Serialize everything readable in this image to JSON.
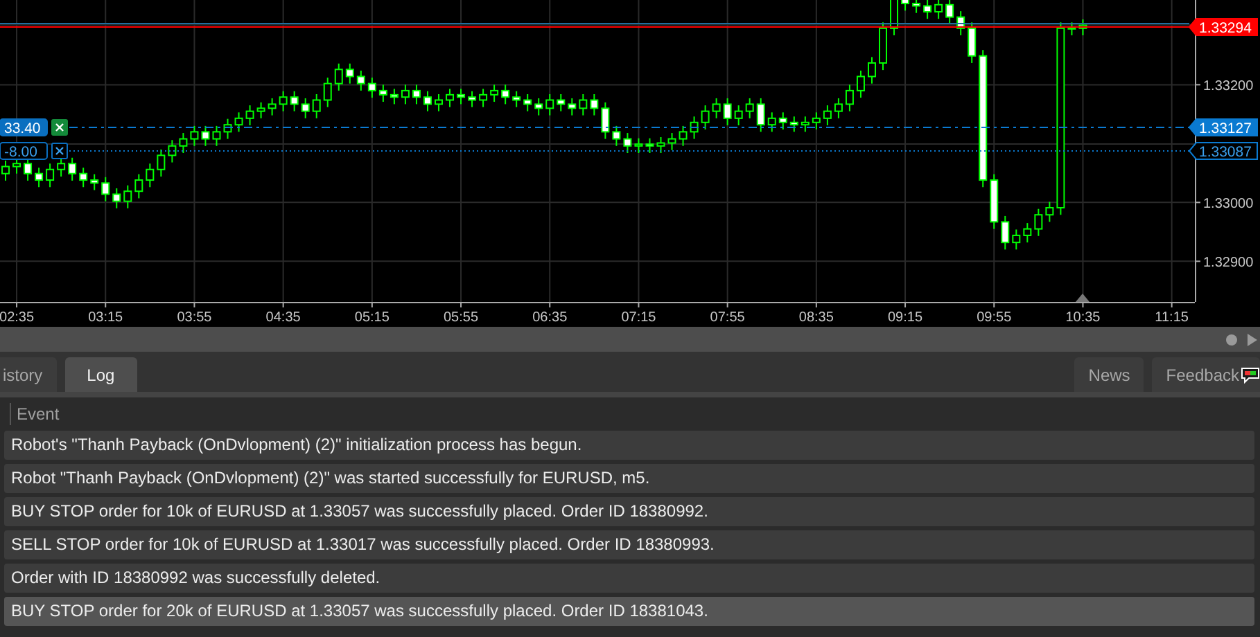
{
  "chart": {
    "chart_data": {
      "type": "candlestick",
      "x": [
        150,
        155,
        160,
        165,
        170,
        175,
        180,
        185,
        190,
        195,
        200,
        205,
        210,
        215,
        220,
        225,
        230,
        235,
        240,
        245,
        250,
        255,
        260,
        265,
        270,
        275,
        280,
        285,
        290,
        295,
        300,
        305,
        310,
        315,
        320,
        325,
        330,
        335,
        340,
        345,
        350,
        355,
        360,
        365,
        370,
        375,
        380,
        385,
        390,
        395,
        400,
        405,
        410,
        415,
        420,
        425,
        430,
        435,
        440,
        445,
        450,
        455,
        460,
        465,
        470,
        475,
        480,
        485,
        490,
        495,
        500,
        505,
        510,
        515,
        520,
        525,
        530,
        535,
        540,
        545,
        550,
        555,
        560,
        565,
        570,
        575,
        580,
        585,
        590,
        595,
        600,
        605,
        610,
        615,
        620,
        625,
        630,
        635
      ],
      "xlim": [
        147.5,
        685.4
      ],
      "grid": true,
      "ohlc": [
        [
          1.33049,
          1.33071,
          1.33037,
          1.33061
        ],
        [
          1.33061,
          1.33076,
          1.33049,
          1.33066
        ],
        [
          1.33066,
          1.33076,
          1.33037,
          1.33049
        ],
        [
          1.33049,
          1.33059,
          1.33026,
          1.33038
        ],
        [
          1.33038,
          1.33066,
          1.33026,
          1.33056
        ],
        [
          1.33056,
          1.33076,
          1.33044,
          1.33066
        ],
        [
          1.33066,
          1.33076,
          1.33037,
          1.33049
        ],
        [
          1.33049,
          1.33059,
          1.33026,
          1.33038
        ],
        [
          1.33038,
          1.33048,
          1.33021,
          1.33033
        ],
        [
          1.33033,
          1.33043,
          1.33002,
          1.33014
        ],
        [
          1.33014,
          1.33024,
          1.3299,
          1.33002
        ],
        [
          1.33002,
          1.33029,
          1.3299,
          1.33019
        ],
        [
          1.33019,
          1.33048,
          1.33007,
          1.33038
        ],
        [
          1.33038,
          1.33066,
          1.33026,
          1.33056
        ],
        [
          1.33056,
          1.3309,
          1.33044,
          1.3308
        ],
        [
          1.3308,
          1.33106,
          1.33068,
          1.33096
        ],
        [
          1.33096,
          1.33118,
          1.33084,
          1.33108
        ],
        [
          1.33108,
          1.3313,
          1.33096,
          1.3312
        ],
        [
          1.3312,
          1.3313,
          1.33096,
          1.33108
        ],
        [
          1.33108,
          1.3313,
          1.33096,
          1.3312
        ],
        [
          1.3312,
          1.33142,
          1.33108,
          1.33132
        ],
        [
          1.33132,
          1.33153,
          1.3312,
          1.33143
        ],
        [
          1.33143,
          1.33165,
          1.33131,
          1.33155
        ],
        [
          1.33155,
          1.3317,
          1.33143,
          1.3316
        ],
        [
          1.3316,
          1.33177,
          1.33148,
          1.33167
        ],
        [
          1.33167,
          1.33189,
          1.33155,
          1.33179
        ],
        [
          1.33179,
          1.33189,
          1.33155,
          1.33167
        ],
        [
          1.33167,
          1.33177,
          1.33143,
          1.33155
        ],
        [
          1.33155,
          1.33184,
          1.33143,
          1.33174
        ],
        [
          1.33174,
          1.33212,
          1.33162,
          1.33202
        ],
        [
          1.33202,
          1.33236,
          1.3319,
          1.33226
        ],
        [
          1.33226,
          1.33236,
          1.33202,
          1.33214
        ],
        [
          1.33214,
          1.33224,
          1.3319,
          1.33202
        ],
        [
          1.33202,
          1.33212,
          1.33178,
          1.3319
        ],
        [
          1.3319,
          1.332,
          1.33171,
          1.33183
        ],
        [
          1.33183,
          1.33193,
          1.33167,
          1.33179
        ],
        [
          1.33179,
          1.332,
          1.33167,
          1.3319
        ],
        [
          1.3319,
          1.332,
          1.33167,
          1.33179
        ],
        [
          1.33179,
          1.33189,
          1.33155,
          1.33167
        ],
        [
          1.33167,
          1.33184,
          1.33155,
          1.33174
        ],
        [
          1.33174,
          1.33193,
          1.33162,
          1.33183
        ],
        [
          1.33183,
          1.33193,
          1.33167,
          1.33179
        ],
        [
          1.33179,
          1.33189,
          1.33162,
          1.33174
        ],
        [
          1.33174,
          1.33193,
          1.33162,
          1.33183
        ],
        [
          1.33183,
          1.332,
          1.33171,
          1.3319
        ],
        [
          1.3319,
          1.332,
          1.33167,
          1.33179
        ],
        [
          1.33179,
          1.33189,
          1.33162,
          1.33174
        ],
        [
          1.33174,
          1.33184,
          1.33155,
          1.33167
        ],
        [
          1.33167,
          1.33177,
          1.33148,
          1.3316
        ],
        [
          1.3316,
          1.33184,
          1.33148,
          1.33174
        ],
        [
          1.33174,
          1.33184,
          1.33155,
          1.33167
        ],
        [
          1.33167,
          1.33177,
          1.33148,
          1.3316
        ],
        [
          1.3316,
          1.33184,
          1.33148,
          1.33174
        ],
        [
          1.33174,
          1.33184,
          1.33148,
          1.3316
        ],
        [
          1.3316,
          1.3317,
          1.33108,
          1.3312
        ],
        [
          1.3312,
          1.3313,
          1.33096,
          1.33108
        ],
        [
          1.33108,
          1.33118,
          1.33084,
          1.33096
        ],
        [
          1.33096,
          1.33109,
          1.33084,
          1.33099
        ],
        [
          1.33099,
          1.33109,
          1.33084,
          1.33096
        ],
        [
          1.33096,
          1.33111,
          1.33084,
          1.33101
        ],
        [
          1.33101,
          1.33118,
          1.33089,
          1.33108
        ],
        [
          1.33108,
          1.3313,
          1.33096,
          1.3312
        ],
        [
          1.3312,
          1.33146,
          1.33108,
          1.33136
        ],
        [
          1.33136,
          1.33165,
          1.33124,
          1.33155
        ],
        [
          1.33155,
          1.33177,
          1.33143,
          1.33167
        ],
        [
          1.33167,
          1.33177,
          1.33131,
          1.33143
        ],
        [
          1.33143,
          1.33165,
          1.33131,
          1.33155
        ],
        [
          1.33155,
          1.33177,
          1.33143,
          1.33167
        ],
        [
          1.33167,
          1.33177,
          1.3312,
          1.33132
        ],
        [
          1.33132,
          1.33153,
          1.3312,
          1.33143
        ],
        [
          1.33143,
          1.33153,
          1.33124,
          1.33136
        ],
        [
          1.33136,
          1.33146,
          1.3312,
          1.33132
        ],
        [
          1.33132,
          1.33146,
          1.3312,
          1.33136
        ],
        [
          1.33136,
          1.33153,
          1.33124,
          1.33143
        ],
        [
          1.33143,
          1.33165,
          1.33131,
          1.33155
        ],
        [
          1.33155,
          1.33177,
          1.33143,
          1.33167
        ],
        [
          1.33167,
          1.332,
          1.33155,
          1.3319
        ],
        [
          1.3319,
          1.33224,
          1.33178,
          1.33214
        ],
        [
          1.33214,
          1.33247,
          1.33202,
          1.33237
        ],
        [
          1.33237,
          1.33306,
          1.33225,
          1.33296
        ],
        [
          1.33296,
          1.33365,
          1.33284,
          1.33355
        ],
        [
          1.33355,
          1.33365,
          1.33326,
          1.33338
        ],
        [
          1.33338,
          1.33348,
          1.33322,
          1.33334
        ],
        [
          1.33334,
          1.33344,
          1.33312,
          1.33324
        ],
        [
          1.33324,
          1.33346,
          1.33312,
          1.33336
        ],
        [
          1.33336,
          1.33346,
          1.33303,
          1.33315
        ],
        [
          1.33315,
          1.33325,
          1.33284,
          1.33296
        ],
        [
          1.33296,
          1.33306,
          1.33237,
          1.33249
        ],
        [
          1.33249,
          1.33259,
          1.33026,
          1.33038
        ],
        [
          1.33038,
          1.33048,
          1.32955,
          1.32967
        ],
        [
          1.32967,
          1.32977,
          1.3292,
          1.32932
        ],
        [
          1.32932,
          1.32954,
          1.3292,
          1.32944
        ],
        [
          1.32944,
          1.32965,
          1.32932,
          1.32955
        ],
        [
          1.32955,
          1.32989,
          1.32943,
          1.32979
        ],
        [
          1.32979,
          1.33001,
          1.32967,
          1.32991
        ],
        [
          1.32991,
          1.33306,
          1.32979,
          1.33296
        ],
        [
          1.33296,
          1.33306,
          1.33284,
          1.33296
        ],
        [
          1.33296,
          1.33311,
          1.33284,
          1.33301
        ]
      ],
      "ylim": [
        1.32831,
        1.33344
      ],
      "yticks": [
        {
          "value": 1.332,
          "label": "1.33200"
        },
        {
          "value": 1.33,
          "label": "1.33000"
        },
        {
          "value": 1.329,
          "label": "1.32900"
        }
      ],
      "xticks": [
        {
          "value": 155,
          "label": "02:35"
        },
        {
          "value": 195,
          "label": "03:15"
        },
        {
          "value": 235,
          "label": "03:55"
        },
        {
          "value": 275,
          "label": "04:35"
        },
        {
          "value": 315,
          "label": "05:15"
        },
        {
          "value": 355,
          "label": "05:55"
        },
        {
          "value": 395,
          "label": "06:35"
        },
        {
          "value": 435,
          "label": "07:15"
        },
        {
          "value": 475,
          "label": "07:55"
        },
        {
          "value": 515,
          "label": "08:35"
        },
        {
          "value": 555,
          "label": "09:15"
        },
        {
          "value": 595,
          "label": "09:55"
        },
        {
          "value": 635,
          "label": "10:35"
        },
        {
          "value": 675,
          "label": "11:15"
        }
      ]
    },
    "price_tags": [
      {
        "kind": "bid",
        "label": "1.33294",
        "color": "#ff0000"
      },
      {
        "kind": "entry",
        "label": "1.33127",
        "color": "#0a7ad1"
      },
      {
        "kind": "pending",
        "label": "1.33087",
        "color": "#0a7ad1"
      }
    ],
    "position_labels": [
      {
        "kind": "entry",
        "label": "33.40"
      },
      {
        "kind": "pending",
        "label": "-8.00"
      }
    ]
  },
  "tabs_left": [
    {
      "label": "istory",
      "selected": false
    },
    {
      "label": "Log",
      "selected": true
    }
  ],
  "tabs_right": [
    {
      "label": "News",
      "selected": false
    },
    {
      "label": "Feedback",
      "selected": false
    }
  ],
  "log": {
    "columns": [
      "Event"
    ],
    "rows": [
      {
        "text": "Robot's \"Thanh Payback (OnDvlopment)  (2)\" initialization process has begun.",
        "selected": false
      },
      {
        "text": "Robot \"Thanh Payback (OnDvlopment)  (2)\" was started successfully for EURUSD, m5.",
        "selected": false
      },
      {
        "text": "BUY STOP order for 10k of EURUSD at 1.33057 was successfully placed. Order ID 18380992.",
        "selected": false
      },
      {
        "text": "SELL STOP order for 10k of EURUSD at 1.33017 was successfully placed. Order ID 18380993.",
        "selected": false
      },
      {
        "text": "Order with ID 18380992 was successfully deleted.",
        "selected": false
      },
      {
        "text": "BUY STOP order for 20k of EURUSD at 1.33057 was successfully placed. Order ID 18381043.",
        "selected": true
      }
    ]
  }
}
